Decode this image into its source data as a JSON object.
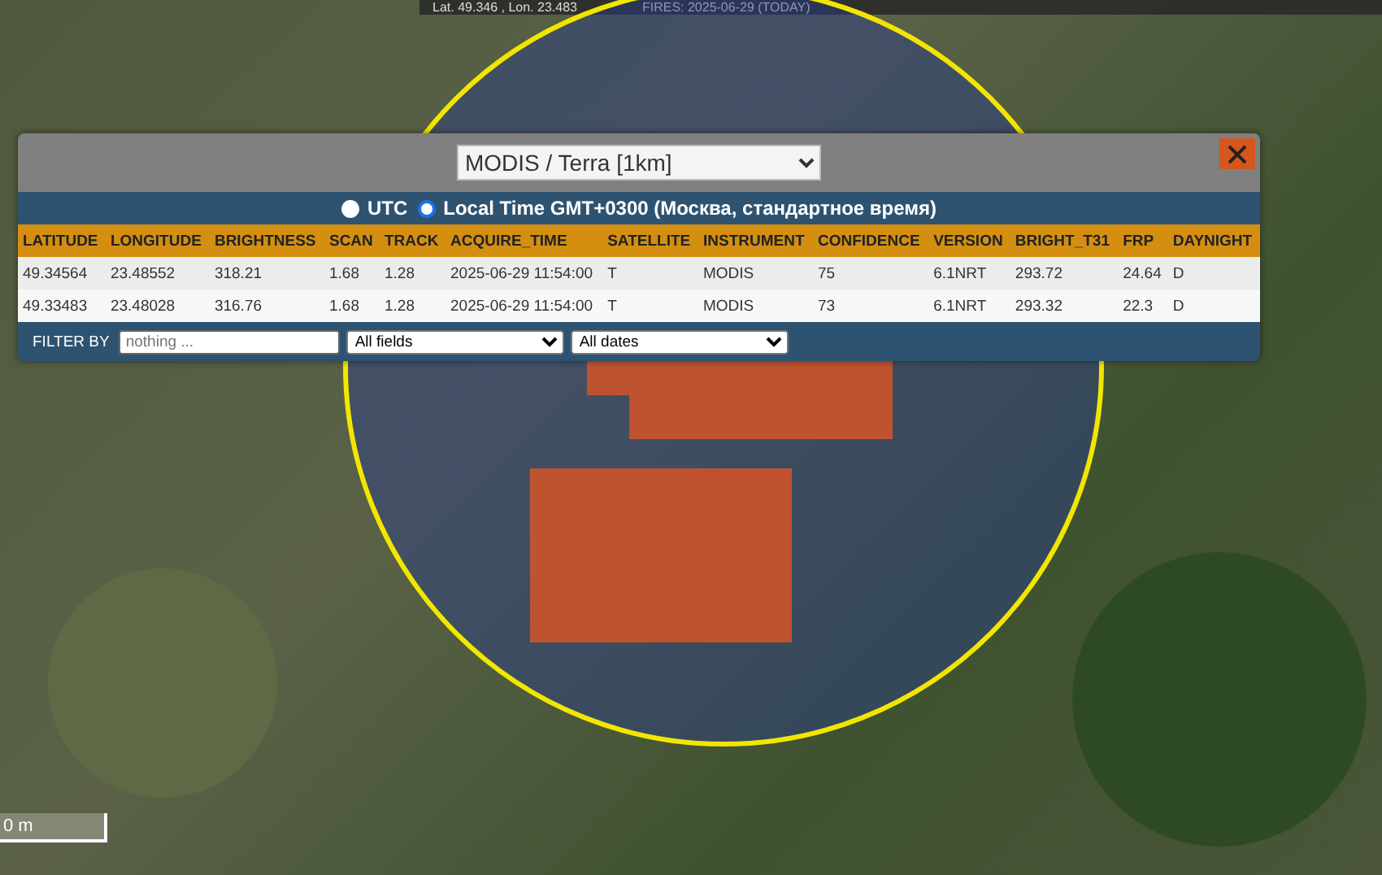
{
  "top_bar": {
    "coordinates": "Lat. 49.346 , Lon. 23.483",
    "fires_date": "FIRES: 2025-06-29 (TODAY)"
  },
  "map": {
    "scale_label": "0 m"
  },
  "panel": {
    "product_select": "MODIS / Terra [1km]",
    "time_modes": [
      {
        "label": "UTC",
        "selected": false
      },
      {
        "label": "Local Time GMT+0300 (Москва, стандартное время)",
        "selected": true
      }
    ],
    "table": {
      "columns": [
        "LATITUDE",
        "LONGITUDE",
        "BRIGHTNESS",
        "SCAN",
        "TRACK",
        "ACQUIRE_TIME",
        "SATELLITE",
        "INSTRUMENT",
        "CONFIDENCE",
        "VERSION",
        "BRIGHT_T31",
        "FRP",
        "DAYNIGHT"
      ],
      "rows": [
        [
          "49.34564",
          "23.48552",
          "318.21",
          "1.68",
          "1.28",
          "2025-06-29 11:54:00",
          "T",
          "MODIS",
          "75",
          "6.1NRT",
          "293.72",
          "24.64",
          "D"
        ],
        [
          "49.33483",
          "23.48028",
          "316.76",
          "1.68",
          "1.28",
          "2025-06-29 11:54:00",
          "T",
          "MODIS",
          "73",
          "6.1NRT",
          "293.32",
          "22.3",
          "D"
        ]
      ]
    },
    "filter": {
      "label": "FILTER BY",
      "placeholder": "nothing ...",
      "field_select": "All fields",
      "date_select": "All dates"
    }
  }
}
